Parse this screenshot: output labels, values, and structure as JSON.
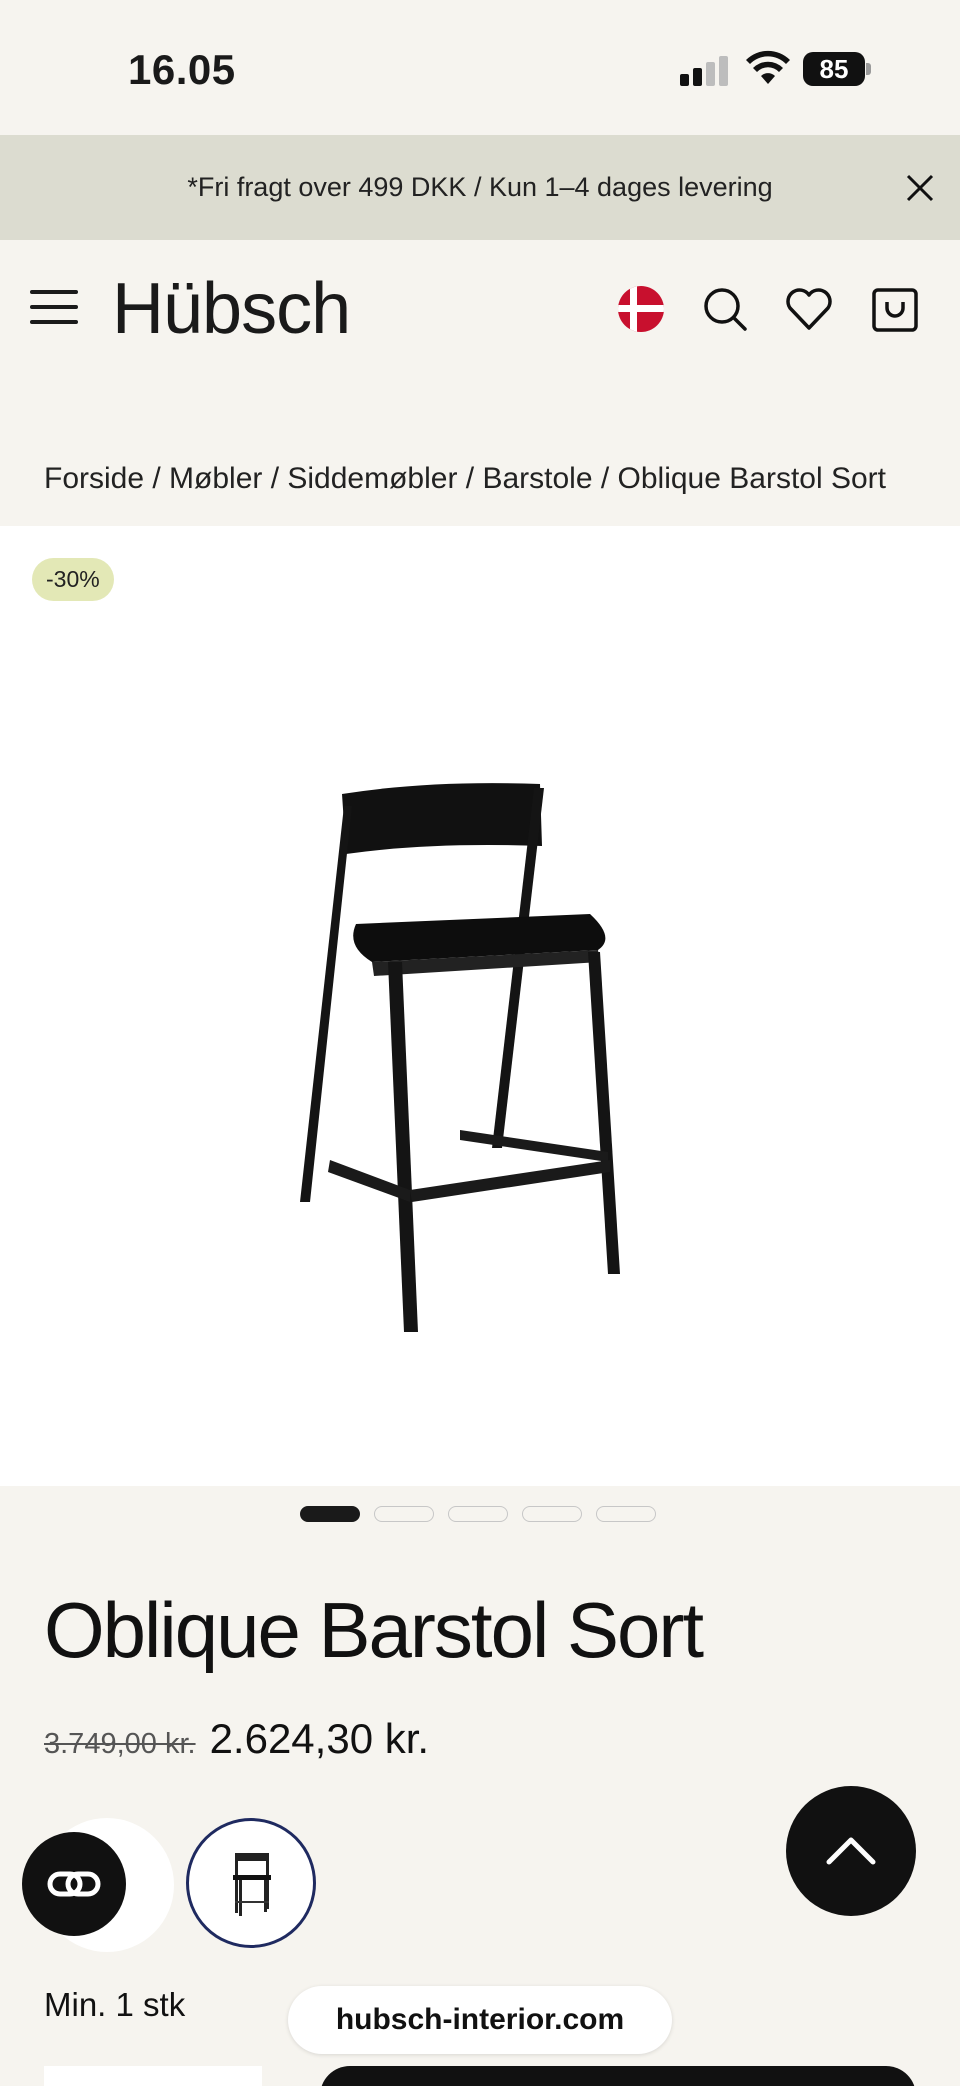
{
  "status_bar": {
    "time": "16.05",
    "battery": "85"
  },
  "announcement": {
    "text": "*Fri fragt over 499 DKK / Kun 1–4 dages levering"
  },
  "header": {
    "logo": "Hübsch"
  },
  "breadcrumb": {
    "text": "Forside / Møbler / Siddemøbler / Barstole / Oblique Barstol Sort"
  },
  "product": {
    "discount_badge": "-30%",
    "title": "Oblique Barstol Sort",
    "old_price": "3.749,00 kr.",
    "new_price": "2.624,30 kr.",
    "min_quantity": "Min. 1 stk"
  },
  "gallery": {
    "slides": 5,
    "active_index": 0
  },
  "browser": {
    "url": "hubsch-interior.com"
  },
  "icons": {
    "menu": "hamburger-icon",
    "language": "denmark-flag-icon",
    "search": "search-icon",
    "wishlist": "heart-icon",
    "cart": "shopping-bag-icon",
    "close": "close-icon",
    "scroll_top": "chevron-up-icon",
    "accessibility": "accessibility-icon"
  },
  "colors": {
    "background": "#f6f4ef",
    "announcement_bg": "#dcdcd0",
    "badge_bg": "#e3e8b6",
    "accent_dark": "#111111",
    "flag_red": "#c8102e"
  }
}
